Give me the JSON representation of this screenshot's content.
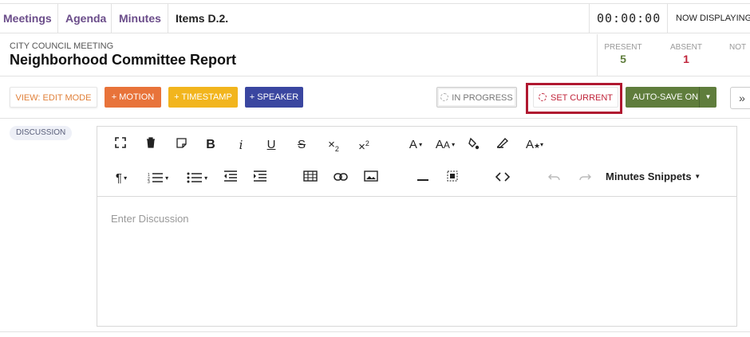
{
  "nav": {
    "meetings": "Meetings",
    "agenda": "Agenda",
    "minutes": "Minutes",
    "current_item": "Items D.2.",
    "timer": "00:00:00",
    "now_displaying": "NOW DISPLAYING"
  },
  "header": {
    "kicker": "CITY COUNCIL MEETING",
    "title": "Neighborhood Committee Report"
  },
  "attendance": {
    "present_label": "PRESENT",
    "present_value": "5",
    "absent_label": "ABSENT",
    "absent_value": "1",
    "not_label": "NOT",
    "present_color": "#5f7d3c",
    "absent_color": "#c0243a"
  },
  "toolbar": {
    "view_mode": "VIEW: EDIT MODE",
    "motion": "+ MOTION",
    "timestamp": "+ TIMESTAMP",
    "speaker": "+ SPEAKER",
    "in_progress": "IN PROGRESS",
    "set_current": "SET CURRENT",
    "autosave": "AUTO-SAVE ON",
    "more_icon": "double-chevron-right-icon"
  },
  "section": {
    "pill": "DISCUSSION"
  },
  "editor": {
    "placeholder": "Enter Discussion",
    "snippets_label": "Minutes Snippets",
    "tools_row1": [
      "fullscreen-icon",
      "trash-icon",
      "note-icon",
      "bold-icon",
      "italic-icon",
      "underline-icon",
      "strikethrough-icon",
      "subscript-icon",
      "superscript-icon",
      "font-color-icon",
      "font-size-icon",
      "fill-color-icon",
      "highlighter-icon",
      "text-style-icon"
    ],
    "tools_row2": [
      "paragraph-icon",
      "ordered-list-icon",
      "unordered-list-icon",
      "outdent-icon",
      "indent-icon",
      "table-icon",
      "link-icon",
      "image-icon",
      "horizontal-rule-icon",
      "select-all-icon",
      "code-view-icon",
      "undo-icon",
      "redo-icon"
    ]
  },
  "colors": {
    "nav_link": "#6b4d8a",
    "motion": "#e8733a",
    "timestamp": "#f2b51d",
    "speaker": "#3a46a0",
    "autosave": "#5f7d3c",
    "highlight_frame": "#b01830"
  }
}
